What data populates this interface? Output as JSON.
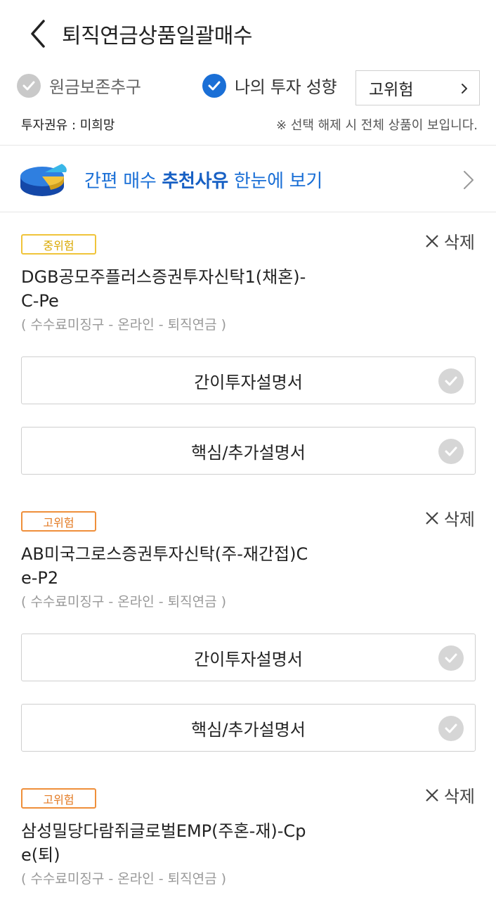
{
  "header": {
    "title": "퇴직연금상품일괄매수"
  },
  "filters": {
    "principal_label": "원금보존추구",
    "principal_checked": false,
    "profile_label": "나의 투자 성향",
    "profile_checked": true,
    "risk_value": "고위험"
  },
  "info": {
    "left": "투자권유 : 미희망",
    "right": "※ 선택 해제 시 전체 상품이 보입니다."
  },
  "banner": {
    "pre": "간편 매수 ",
    "bold": "추천사유",
    "post": " 한눈에 보기"
  },
  "colors": {
    "accent": "#1a6fd6",
    "badge_mid": "#f0c43a",
    "badge_high": "#ef8f3a"
  },
  "products": [
    {
      "risk": "중위험",
      "delete": "삭제",
      "name_line1": "DGB공모주플러스증권투자신탁1(채혼)-",
      "name_line2": "C-Pe",
      "sub": "( 수수료미징구 - 온라인 - 퇴직연금 )",
      "doc1": "간이투자설명서",
      "doc2": "핵심/추가설명서"
    },
    {
      "risk": "고위험",
      "delete": "삭제",
      "name_line1": "AB미국그로스증권투자신탁(주-재간접)C",
      "name_line2": "e-P2",
      "sub": "( 수수료미징구 - 온라인 - 퇴직연금 )",
      "doc1": "간이투자설명서",
      "doc2": "핵심/추가설명서"
    },
    {
      "risk": "고위험",
      "delete": "삭제",
      "name_line1": "삼성밀당다람쥐글로벌EMP(주혼-재)-Cp",
      "name_line2": "e(퇴)",
      "sub": "( 수수료미징구 - 온라인 - 퇴직연금 )"
    }
  ]
}
